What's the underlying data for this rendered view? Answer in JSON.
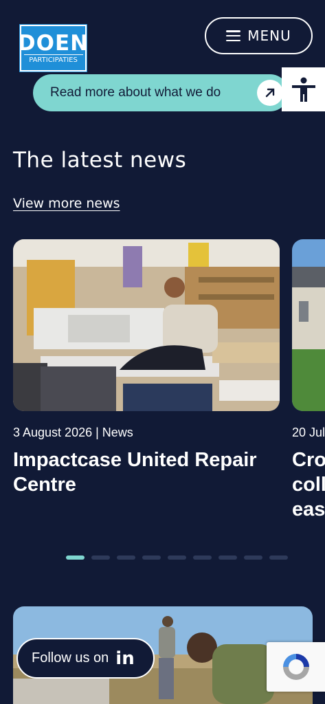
{
  "header": {
    "logo": {
      "main": "DOEN",
      "sub": "PARTICIPATIES"
    },
    "menu_label": "MENU"
  },
  "banner": {
    "label": "Read more about what we do",
    "icon": "arrow-up-right-icon"
  },
  "accessibility": {
    "icon": "accessibility-person-icon"
  },
  "news": {
    "title": "The latest news",
    "view_more": "View more news",
    "cards": [
      {
        "meta": "3 August 2026 | News",
        "title_line1": "Impactcase United Repair",
        "title_line2": "Centre"
      },
      {
        "meta": "20 Jul",
        "title_line1": "Cro",
        "title_line2": "coll",
        "title_line3": "eas"
      }
    ],
    "carousel": {
      "total": 9,
      "active": 1
    }
  },
  "follow": {
    "label": "Follow us on",
    "network": "in"
  },
  "colors": {
    "background": "#111a36",
    "accent": "#7fd6d0",
    "logo_blue": "#1f8fd8"
  }
}
